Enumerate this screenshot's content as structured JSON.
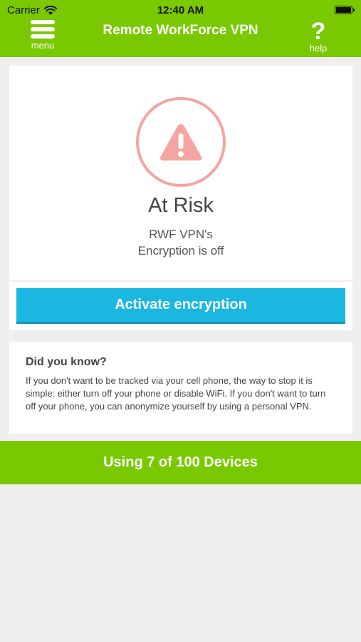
{
  "status_bar": {
    "carrier": "Carrier",
    "time": "12:40 AM"
  },
  "nav": {
    "menu_label": "menu",
    "title": "Remote WorkForce VPN",
    "help_label": "help",
    "help_glyph": "?"
  },
  "status": {
    "icon": "warning-icon",
    "title": "At Risk",
    "line1": "RWF VPN's",
    "line2": "Encryption is off",
    "color": "#f4a5a1"
  },
  "action": {
    "activate_label": "Activate encryption"
  },
  "tip": {
    "title": "Did you know?",
    "body": "If you don't want to be tracked via your cell phone, the way to stop it is simple: either turn off your phone or disable WiFi. If you don't want to turn off your phone, you can anonymize yourself by using a personal VPN."
  },
  "devices": {
    "label": "Using 7 of 100 Devices"
  },
  "colors": {
    "brand_green": "#7ac800",
    "accent_blue": "#1bb7e0",
    "warning_pink": "#f4a5a1"
  }
}
